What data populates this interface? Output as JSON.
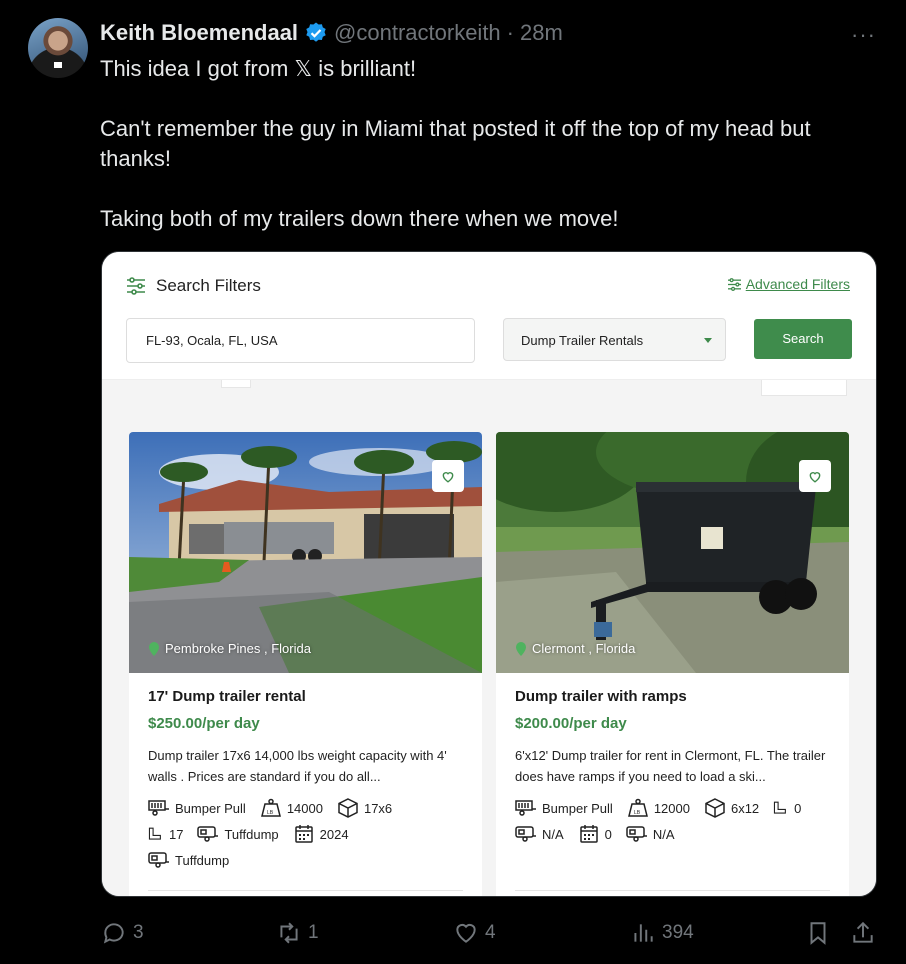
{
  "tweet": {
    "author_name": "Keith Bloemendaal",
    "handle": "@contractorkeith",
    "separator": "·",
    "time": "28m",
    "more": "···",
    "lines": [
      "This idea I got from 𝕏 is brilliant!",
      "Can't remember the guy in Miami that posted it off the top of my head but thanks!",
      "Taking both of my trailers down there when we move!"
    ]
  },
  "embed": {
    "filters_title": "Search Filters",
    "advanced_filters": "Advanced Filters",
    "location_value": "FL-93, Ocala, FL, USA",
    "category_selected": "Dump Trailer Rentals",
    "search_label": "Search",
    "listings": [
      {
        "location": "Pembroke Pines , Florida",
        "title": "17' Dump trailer rental",
        "price": "$250.00/per day",
        "description": "Dump trailer 17x6 14,000 lbs weight capacity with 4' walls . Prices are standard if you do all...",
        "specs": {
          "hitch": "Bumper Pull",
          "capacity": "14000",
          "size": "17x6",
          "length": "17",
          "make": "Tuffdump",
          "year": "2024",
          "model": "Tuffdump"
        }
      },
      {
        "location": "Clermont , Florida",
        "title": "Dump trailer with ramps",
        "price": "$200.00/per day",
        "description": "6'x12' Dump trailer for rent in Clermont, FL. The trailer does have ramps if you need to load a ski...",
        "specs": {
          "hitch": "Bumper Pull",
          "capacity": "12000",
          "size": "6x12",
          "length": "0",
          "make": "N/A",
          "year": "0",
          "model": "N/A"
        }
      }
    ]
  },
  "actions": {
    "replies": "3",
    "reposts": "1",
    "likes": "4",
    "views": "394"
  },
  "colors": {
    "accent_green": "#3f8c4c",
    "verified_blue": "#1d9bf0",
    "muted": "#71767b"
  }
}
